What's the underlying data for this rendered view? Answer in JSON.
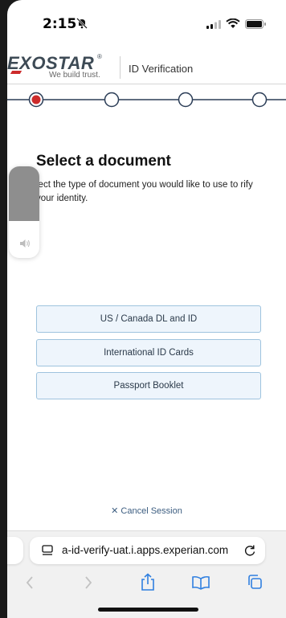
{
  "status_bar": {
    "time": "2:15"
  },
  "header": {
    "logo_text": "EXOSTAR",
    "logo_tagline": "We build trust.",
    "title": "ID Verification"
  },
  "stepper": {
    "total_steps": 4,
    "current_step": 1,
    "active_color": "#cc2b2b",
    "line_color": "#2b3d57"
  },
  "main": {
    "heading": "Select a document",
    "description": "lect the type of document you would like to use to rify your identity.",
    "options": [
      {
        "label": "US / Canada DL and ID"
      },
      {
        "label": "International ID Cards"
      },
      {
        "label": "Passport Booklet"
      }
    ],
    "cancel_label": "Cancel Session"
  },
  "volume_hud": {
    "level": 0.6
  },
  "browser": {
    "url": "a-id-verify-uat.i.apps.experian.com"
  },
  "colors": {
    "accent": "#cc2b2b",
    "button_border": "#9ec3de",
    "button_bg": "#eef5fc"
  }
}
